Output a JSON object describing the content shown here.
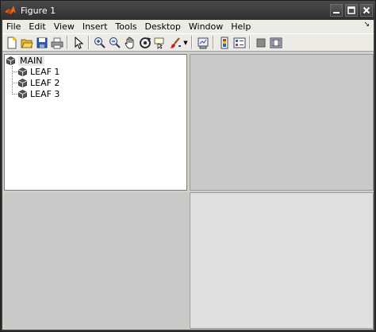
{
  "window": {
    "title": "Figure 1",
    "controls": [
      "minimize",
      "maximize",
      "close"
    ]
  },
  "menubar": {
    "items": [
      "File",
      "Edit",
      "View",
      "Insert",
      "Tools",
      "Desktop",
      "Window",
      "Help"
    ]
  },
  "toolbar": {
    "buttons": [
      "new-figure-icon",
      "open-file-icon",
      "save-icon",
      "print-icon",
      "edit-plot-icon",
      "zoom-in-icon",
      "zoom-out-icon",
      "pan-icon",
      "rotate-3d-icon",
      "data-cursor-icon",
      "brush-icon",
      "link-plot-icon",
      "insert-colorbar-icon",
      "insert-legend-icon",
      "hide-plot-tools-icon",
      "show-plot-tools-icon"
    ]
  },
  "tree": {
    "root": "MAIN",
    "children": [
      "LEAF 1",
      "LEAF 2",
      "LEAF 3"
    ]
  },
  "colors": {
    "titlebar": "#3a3a3a",
    "menubar": "#ecebe6",
    "panel_gray": "#c9c9c9",
    "panel_light": "#e0e0e0"
  }
}
